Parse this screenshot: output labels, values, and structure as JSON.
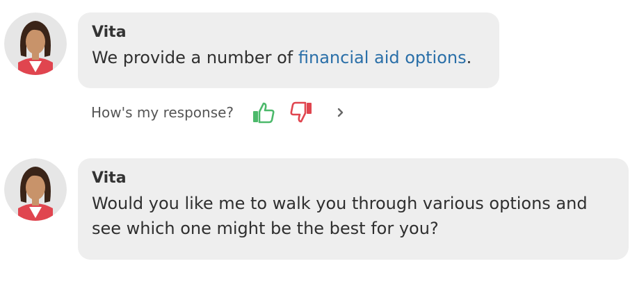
{
  "messages": [
    {
      "sender": "Vita",
      "text_before": "We provide a number of ",
      "link_text": "financial aid options",
      "text_after": "."
    },
    {
      "sender": "Vita",
      "text": "Would you like me to walk you through various options and see which one might be the best for you?"
    }
  ],
  "feedback": {
    "label": "How's my response?",
    "thumbs_up_icon": "thumbs-up-icon",
    "thumbs_down_icon": "thumbs-down-icon",
    "more_icon": "chevron-right-icon"
  },
  "colors": {
    "bubble": "#eeeeee",
    "link": "#2a6fa8",
    "thumbs_up": "#4cb96b",
    "thumbs_down": "#e0454f",
    "avatar_bg": "#e6e6e6"
  }
}
